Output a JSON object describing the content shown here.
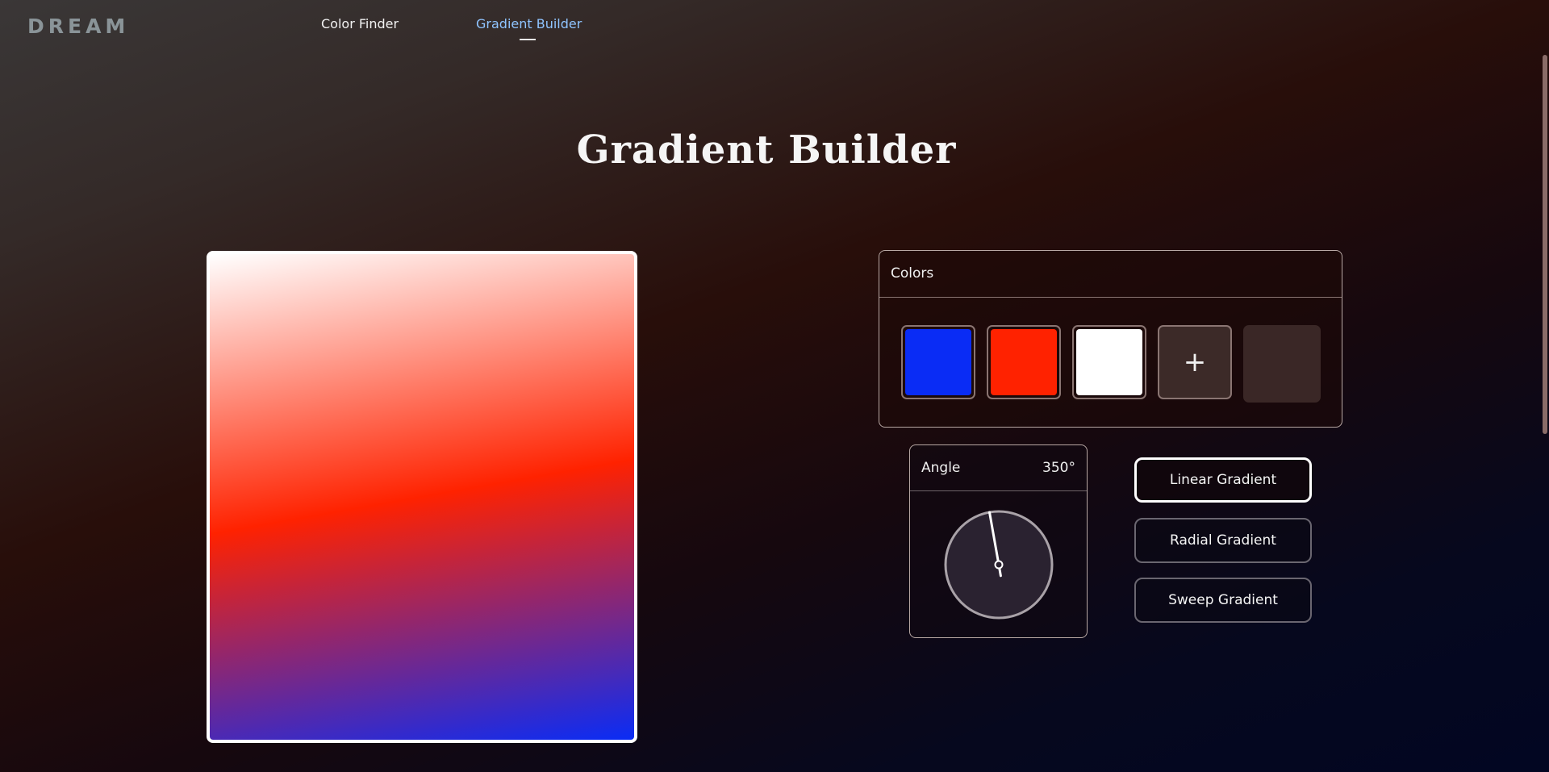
{
  "header": {
    "logo": "DREAM",
    "nav": [
      {
        "label": "Color Finder",
        "active": false
      },
      {
        "label": "Gradient Builder",
        "active": true
      }
    ]
  },
  "page_title": "Gradient Builder",
  "preview": {
    "angle_deg": 350,
    "gradient_stops": [
      "#0a2cf5",
      "#ff2200",
      "#ffffff"
    ]
  },
  "colors_panel": {
    "title": "Colors",
    "swatches": [
      "#0a2cf5",
      "#ff2200",
      "#ffffff"
    ],
    "add_label": "+"
  },
  "angle_panel": {
    "label": "Angle",
    "value": "350°",
    "degrees": 350
  },
  "gradient_types": [
    {
      "label": "Linear Gradient",
      "selected": true
    },
    {
      "label": "Radial Gradient",
      "selected": false
    },
    {
      "label": "Sweep Gradient",
      "selected": false
    }
  ]
}
